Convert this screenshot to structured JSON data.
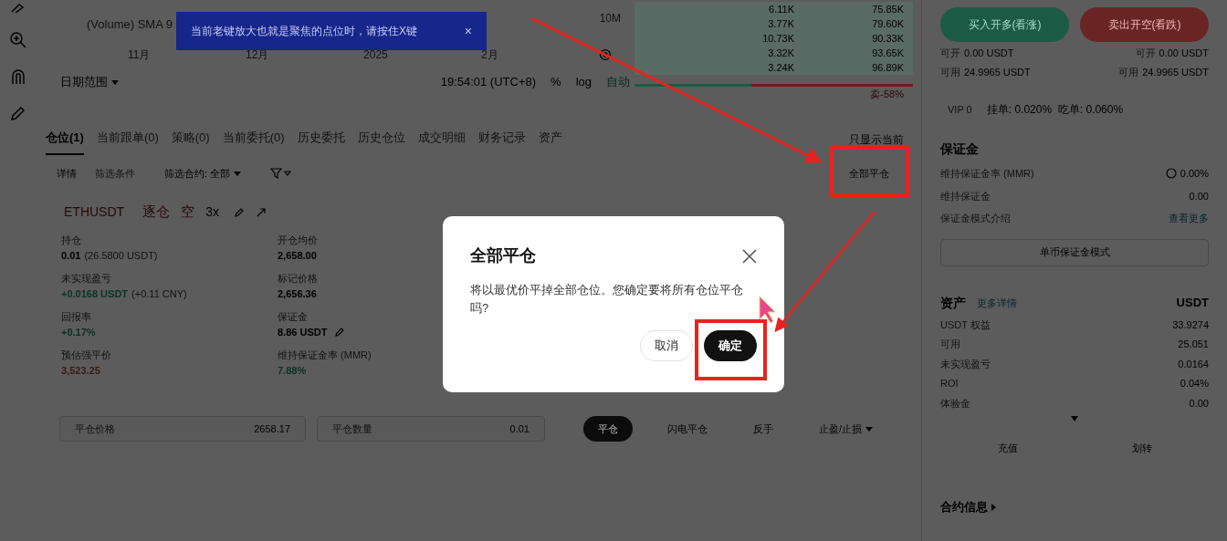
{
  "chart": {
    "legend": "(Volume) SMA 9",
    "scale_label": "10M",
    "x_axis": [
      "11月",
      "12月",
      "2025",
      "2月"
    ],
    "date_range": "日期范围",
    "time": "19:54:01 (UTC+8)",
    "options": [
      "%",
      "log",
      "自动"
    ]
  },
  "toast": {
    "text": "当前老键放大也就是聚焦的点位时，请按住X键",
    "close": "×"
  },
  "order_book": {
    "rows": [
      {
        "size": "6.11K",
        "total": "75.85K"
      },
      {
        "size": "3.77K",
        "total": "79.60K"
      },
      {
        "size": "10.73K",
        "total": "90.33K"
      },
      {
        "size": "3.32K",
        "total": "93.65K"
      },
      {
        "size": "3.24K",
        "total": "96.89K"
      }
    ],
    "level": 0.42,
    "sell_ratio": "卖-58%"
  },
  "tabs": [
    {
      "label": "仓位(1)",
      "selected": true
    },
    {
      "label": "当前跟单(0)",
      "selected": false
    },
    {
      "label": "策略(0)",
      "selected": false
    },
    {
      "label": "当前委托(0)",
      "selected": false
    },
    {
      "label": "历史委托",
      "selected": false
    },
    {
      "label": "历史仓位",
      "selected": false
    },
    {
      "label": "成交明细",
      "selected": false
    },
    {
      "label": "财务记录",
      "selected": false
    },
    {
      "label": "资产",
      "selected": false
    }
  ],
  "show_current": "只显示当前",
  "close_all_button": "全部平仓",
  "filter": {
    "details": "详情",
    "conditions": "筛选条件",
    "contract_label": "筛选合约: 全部"
  },
  "position": {
    "symbol": "ETHUSDT",
    "margin_mode": "逐仓",
    "side": {
      "label": "空",
      "kind": "short"
    },
    "leverage": "3x",
    "fields": [
      {
        "label": "持仓",
        "value": "0.01",
        "extra": "(26.5800 USDT)",
        "color": "#000000"
      },
      {
        "label": "开仓均价",
        "value": "2,658.00",
        "color": "#000000"
      },
      {
        "label": "未实现盈亏",
        "value": "+0.0168 USDT",
        "extra": "(+0.11 CNY)",
        "color": "#0a3325"
      },
      {
        "label": "标记价格",
        "value": "2,656.36",
        "color": "#000000"
      },
      {
        "label": "回报率",
        "value": "+0.17%",
        "color": "#0a3325"
      },
      {
        "label": "保证金",
        "value": "8.86 USDT",
        "color": "#000000",
        "editable": true
      },
      {
        "label": "预估强平价",
        "value": "3,523.25",
        "color": "#3a1a10"
      },
      {
        "label": "维持保证金率 (MMR)",
        "value": "7.88%",
        "color": "#0a3325"
      }
    ]
  },
  "close_row": {
    "price_label": "平仓价格",
    "price": "2658.17",
    "amount_label": "平仓数量",
    "amount": "0.01",
    "buttons": [
      {
        "label": "平仓",
        "kind": "primary"
      },
      {
        "label": "闪电平仓",
        "kind": "text"
      },
      {
        "label": "反手",
        "kind": "text"
      },
      {
        "label": "止盈/止损",
        "kind": "menu"
      }
    ]
  },
  "trade": {
    "buy": "买入开多(看涨)",
    "sell": "卖出开空(看跌)",
    "lines": [
      {
        "left": "可开",
        "left_value": "0.00 USDT",
        "right": "可开",
        "right_value": "0.00 USDT"
      },
      {
        "left": "可用",
        "left_value": "24.9965 USDT",
        "right": "可用",
        "right_value": "24.9965 USDT"
      }
    ],
    "vip": "VIP 0",
    "fees": "挂单: 0.020%  吃单: 0.060%"
  },
  "margin": {
    "title": "保证金",
    "rows": [
      {
        "label": "维持保证金率 (MMR)",
        "value": "0.00%",
        "kind": "gauge"
      },
      {
        "label": "维持保证金",
        "value": "0.00",
        "kind": "plain"
      },
      {
        "label": "保证金模式介绍",
        "value": "查看更多",
        "kind": "link"
      }
    ],
    "mode_button": "单币保证金模式"
  },
  "assets": {
    "title": "资产",
    "link": "更多详情",
    "currency": "USDT",
    "rows": [
      {
        "label": "USDT 权益",
        "value": "33.9274"
      },
      {
        "label": "可用",
        "value": "25.051"
      },
      {
        "label": "未实现盈亏",
        "value": "0.0164"
      },
      {
        "label": "ROI",
        "value": "0.04%"
      },
      {
        "label": "体验金",
        "value": "0.00"
      }
    ],
    "buttons": [
      "充值",
      "划转"
    ]
  },
  "contract_info": "合约信息",
  "dialog": {
    "title": "全部平仓",
    "message": "将以最优价平掉全部仓位。您确定要将所有仓位平仓吗?",
    "cancel": "取消",
    "confirm": "确定"
  }
}
